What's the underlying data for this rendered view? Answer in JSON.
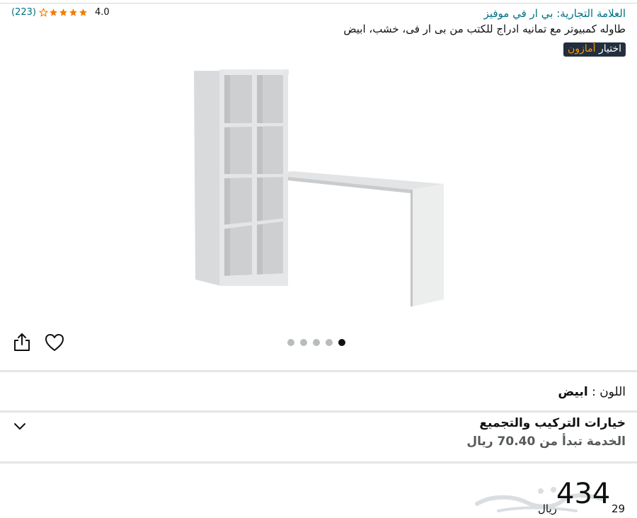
{
  "header": {
    "brand_prefix": "العلامة التجارية:",
    "brand_name": "بي ار في موفيز",
    "product_title": "طاوله كمبيوتر مع تمانيه ادراج للكتب من بى ار فى، خشب، ابيض",
    "badge_text": "اختيار",
    "badge_accent": "أمازون"
  },
  "rating": {
    "average": "4.0",
    "count": "(223)",
    "stars": 4,
    "star_color": "#f57c00"
  },
  "gallery": {
    "image_count": 5,
    "active_index": 4,
    "image_icon": "desk-bookshelf-image",
    "share_icon": "share-icon",
    "wishlist_icon": "heart-icon"
  },
  "variation": {
    "color_label": "اللون :",
    "color_value": "ابيض"
  },
  "assembly": {
    "title": "خيارات التركيب والتجميع",
    "subtitle": "الخدمة تبدأ من 70.40 ريال",
    "expand_icon": "chevron-down-icon"
  },
  "price": {
    "currency": "ريال",
    "whole": "434",
    "fraction": "29"
  },
  "colors": {
    "link": "#007185",
    "badge_bg": "#232f3e",
    "badge_accent": "#ff9900",
    "divider": "#e3e6e6"
  }
}
